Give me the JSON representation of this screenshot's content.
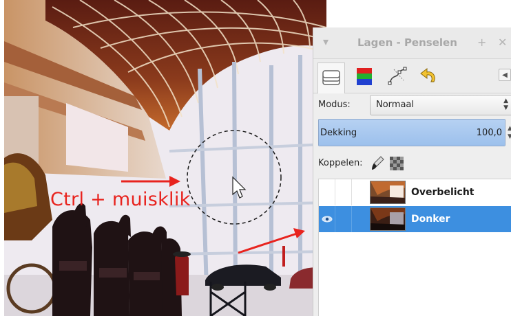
{
  "canvas": {
    "annotation": "Ctrl + muisklik",
    "accent_color": "#e8231e"
  },
  "dock": {
    "title": "Lagen - Penselen",
    "tabs": [
      {
        "icon": "layers-icon"
      },
      {
        "icon": "channels-icon"
      },
      {
        "icon": "paths-icon"
      },
      {
        "icon": "undo-history-icon"
      }
    ],
    "modus_label": "Modus:",
    "modus_value": "Normaal",
    "dekking_label": "Dekking",
    "dekking_value": "100,0",
    "dekking_fraction": 1.0,
    "koppelen_label": "Koppelen:",
    "layers": [
      {
        "name": "Overbelicht",
        "visible": false,
        "selected": false
      },
      {
        "name": "Donker",
        "visible": true,
        "selected": true
      }
    ],
    "selection_color": "#3d8fe0"
  }
}
